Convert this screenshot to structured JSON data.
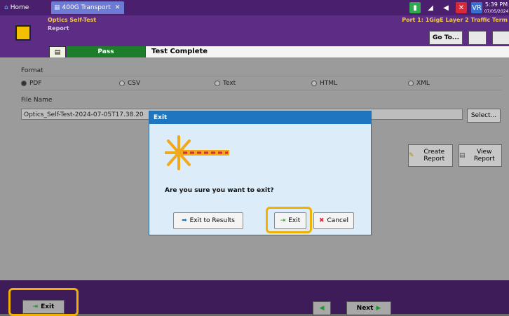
{
  "tabs": {
    "home": "Home",
    "transport": "400G Transport",
    "close": "✕"
  },
  "status": {
    "clock_time": "5:39 PM",
    "clock_date": "07/05/2024",
    "vr_label": "VR"
  },
  "header": {
    "title": "Optics Self-Test",
    "subtitle": "Report",
    "port_info": "Port 1: 1GigE Layer 2 Traffic Term",
    "goto_label": "Go To..."
  },
  "strip": {
    "result": "Pass",
    "status": "Test Complete"
  },
  "format": {
    "label": "Format",
    "options": [
      "PDF",
      "CSV",
      "Text",
      "HTML",
      "XML"
    ],
    "selected": "PDF"
  },
  "file": {
    "label": "File Name",
    "value": "Optics_Self-Test-2024-07-05T17.38.20",
    "select_label": "Select..."
  },
  "actions": {
    "create_report": "Create Report",
    "view_report": "View Report"
  },
  "footer": {
    "exit_label": "Exit",
    "next_label": "Next"
  },
  "dialog": {
    "title": "Exit",
    "question": "Are you sure you want to exit?",
    "exit_to_results": "Exit to Results",
    "exit": "Exit",
    "cancel": "Cancel"
  },
  "colors": {
    "accent": "#5d2d86",
    "pass": "#1d7d2b",
    "highlight": "#f2b100",
    "dialog_title": "#1f76c0"
  }
}
